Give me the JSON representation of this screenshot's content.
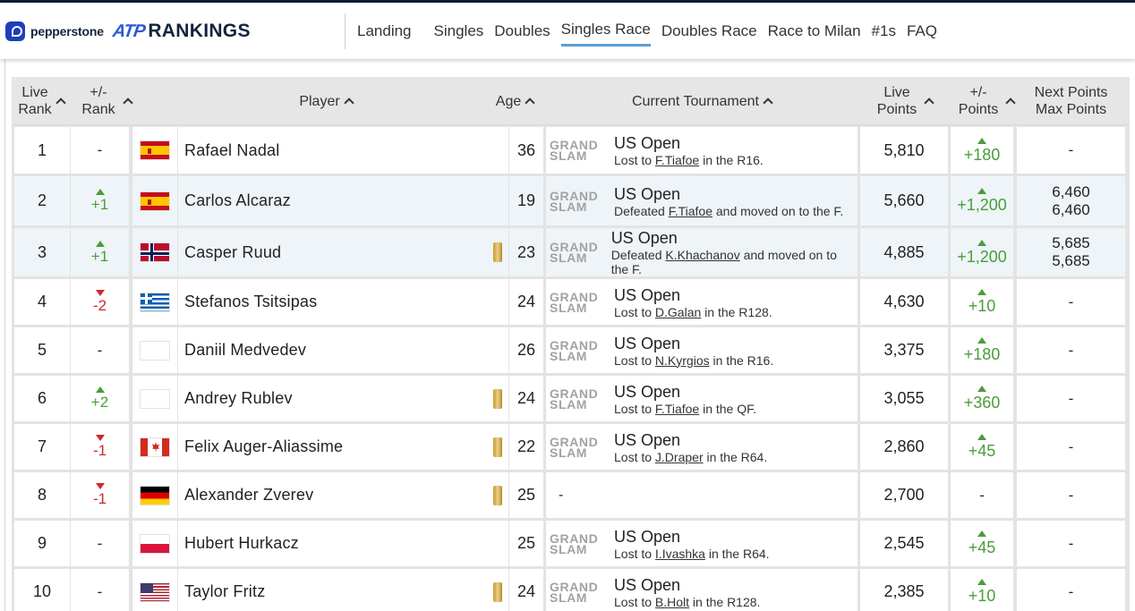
{
  "header": {
    "brand_sponsor": "pepperstone",
    "brand_atp": "ATP",
    "brand_title": "RANKINGS",
    "nav": [
      "Landing",
      "Singles",
      "Doubles",
      "Singles Race",
      "Doubles Race",
      "Race to Milan",
      "#1s",
      "FAQ"
    ],
    "active_nav": "Singles Race"
  },
  "columns": {
    "live_rank": [
      "Live",
      "Rank"
    ],
    "rank_change": [
      "+/-",
      "Rank"
    ],
    "player": "Player",
    "age": "Age",
    "tournament": "Current Tournament",
    "live_points": [
      "Live",
      "Points"
    ],
    "points_change": [
      "+/-",
      "Points"
    ],
    "next_points": [
      "Next Points",
      "Max Points"
    ]
  },
  "colors": {
    "up": "#4a9d3a",
    "down": "#d0282e",
    "highlight_row": "#eef4f8",
    "nav_active": "#5a9fd4"
  },
  "rows": [
    {
      "rank": "1",
      "move": "-",
      "dir": "none",
      "flag": "spain",
      "player": "Rafael Nadal",
      "badge": false,
      "age": "36",
      "tour_logo": [
        "GRAND",
        "SLAM"
      ],
      "tour": "US Open",
      "note_pre": "Lost to ",
      "opp": "F.Tiafoe",
      "note_post": " in the R16.",
      "points": "5,810",
      "pdelta": "+180",
      "pdir": "up",
      "next": "-",
      "max": ""
    },
    {
      "rank": "2",
      "move": "+1",
      "dir": "up",
      "flag": "spain",
      "player": "Carlos Alcaraz",
      "badge": false,
      "age": "19",
      "tour_logo": [
        "GRAND",
        "SLAM"
      ],
      "tour": "US Open",
      "note_pre": "Defeated ",
      "opp": "F.Tiafoe",
      "note_post": " and moved on to the F.",
      "points": "5,660",
      "pdelta": "+1,200",
      "pdir": "up",
      "next": "6,460",
      "max": "6,460"
    },
    {
      "rank": "3",
      "move": "+1",
      "dir": "up",
      "flag": "norway",
      "player": "Casper Ruud",
      "badge": true,
      "age": "23",
      "tour_logo": [
        "GRAND",
        "SLAM"
      ],
      "tour": "US Open",
      "note_pre": "Defeated ",
      "opp": "K.Khachanov",
      "note_post": " and moved on to the F.",
      "points": "4,885",
      "pdelta": "+1,200",
      "pdir": "up",
      "next": "5,685",
      "max": "5,685"
    },
    {
      "rank": "4",
      "move": "-2",
      "dir": "down",
      "flag": "greece",
      "player": "Stefanos Tsitsipas",
      "badge": false,
      "age": "24",
      "tour_logo": [
        "GRAND",
        "SLAM"
      ],
      "tour": "US Open",
      "note_pre": "Lost to ",
      "opp": "D.Galan",
      "note_post": " in the R128.",
      "points": "4,630",
      "pdelta": "+10",
      "pdir": "up",
      "next": "-",
      "max": ""
    },
    {
      "rank": "5",
      "move": "-",
      "dir": "none",
      "flag": "none",
      "player": "Daniil Medvedev",
      "badge": false,
      "age": "26",
      "tour_logo": [
        "GRAND",
        "SLAM"
      ],
      "tour": "US Open",
      "note_pre": "Lost to ",
      "opp": "N.Kyrgios",
      "note_post": " in the R16.",
      "points": "3,375",
      "pdelta": "+180",
      "pdir": "up",
      "next": "-",
      "max": ""
    },
    {
      "rank": "6",
      "move": "+2",
      "dir": "up",
      "flag": "none",
      "player": "Andrey Rublev",
      "badge": true,
      "age": "24",
      "tour_logo": [
        "GRAND",
        "SLAM"
      ],
      "tour": "US Open",
      "note_pre": "Lost to ",
      "opp": "F.Tiafoe",
      "note_post": " in the QF.",
      "points": "3,055",
      "pdelta": "+360",
      "pdir": "up",
      "next": "-",
      "max": ""
    },
    {
      "rank": "7",
      "move": "-1",
      "dir": "down",
      "flag": "canada",
      "player": "Felix Auger-Aliassime",
      "badge": true,
      "age": "22",
      "tour_logo": [
        "GRAND",
        "SLAM"
      ],
      "tour": "US Open",
      "note_pre": "Lost to ",
      "opp": "J.Draper",
      "note_post": " in the R64.",
      "points": "2,860",
      "pdelta": "+45",
      "pdir": "up",
      "next": "-",
      "max": ""
    },
    {
      "rank": "8",
      "move": "-1",
      "dir": "down",
      "flag": "germany",
      "player": "Alexander Zverev",
      "badge": true,
      "age": "25",
      "tour_logo": [],
      "tour": "-",
      "note_pre": "",
      "opp": "",
      "note_post": "",
      "points": "2,700",
      "pdelta": "-",
      "pdir": "none",
      "next": "-",
      "max": ""
    },
    {
      "rank": "9",
      "move": "-",
      "dir": "none",
      "flag": "poland",
      "player": "Hubert Hurkacz",
      "badge": false,
      "age": "25",
      "tour_logo": [
        "GRAND",
        "SLAM"
      ],
      "tour": "US Open",
      "note_pre": "Lost to ",
      "opp": "I.Ivashka",
      "note_post": " in the R64.",
      "points": "2,545",
      "pdelta": "+45",
      "pdir": "up",
      "next": "-",
      "max": ""
    },
    {
      "rank": "10",
      "move": "-",
      "dir": "none",
      "flag": "usa",
      "player": "Taylor Fritz",
      "badge": true,
      "age": "24",
      "tour_logo": [
        "GRAND",
        "SLAM"
      ],
      "tour": "US Open",
      "note_pre": "Lost to ",
      "opp": "B.Holt",
      "note_post": " in the R128.",
      "points": "2,385",
      "pdelta": "+10",
      "pdir": "up",
      "next": "-",
      "max": ""
    }
  ]
}
